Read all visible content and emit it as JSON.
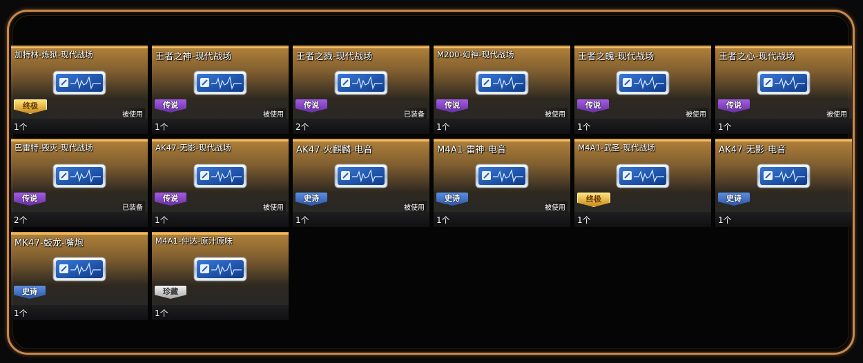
{
  "items": [
    {
      "title": "加特林-炼狱-现代战场",
      "rarity": "终极",
      "rarity_class": "ultimate",
      "status": "被使用",
      "count": "1个",
      "small": true
    },
    {
      "title": "王者之神-现代战场",
      "rarity": "传说",
      "rarity_class": "legend",
      "status": "被使用",
      "count": "1个",
      "small": false
    },
    {
      "title": "王者之戮-现代战场",
      "rarity": "传说",
      "rarity_class": "legend",
      "status": "已装备",
      "count": "2个",
      "small": false
    },
    {
      "title": "M200-幻神-现代战场",
      "rarity": "传说",
      "rarity_class": "legend",
      "status": "被使用",
      "count": "1个",
      "small": true
    },
    {
      "title": "王者之魄-现代战场",
      "rarity": "传说",
      "rarity_class": "legend",
      "status": "被使用",
      "count": "1个",
      "small": false
    },
    {
      "title": "王者之心-现代战场",
      "rarity": "传说",
      "rarity_class": "legend",
      "status": "被使用",
      "count": "1个",
      "small": false
    },
    {
      "title": "巴雷特-毁灭-现代战场",
      "rarity": "传说",
      "rarity_class": "legend",
      "status": "已装备",
      "count": "2个",
      "small": true
    },
    {
      "title": "AK47-无影-现代战场",
      "rarity": "传说",
      "rarity_class": "legend",
      "status": "被使用",
      "count": "1个",
      "small": true
    },
    {
      "title": "AK47-火麒麟-电音",
      "rarity": "史诗",
      "rarity_class": "epic",
      "status": "被使用",
      "count": "1个",
      "small": false
    },
    {
      "title": "M4A1-雷神-电音",
      "rarity": "史诗",
      "rarity_class": "epic",
      "status": "被使用",
      "count": "1个",
      "small": false
    },
    {
      "title": "M4A1-武圣-现代战场",
      "rarity": "终极",
      "rarity_class": "ultimate",
      "status": "",
      "count": "1个",
      "small": true
    },
    {
      "title": "AK47-无影-电音",
      "rarity": "史诗",
      "rarity_class": "epic",
      "status": "",
      "count": "1个",
      "small": false
    },
    {
      "title": "MK47-鼓龙-嘴炮",
      "rarity": "史诗",
      "rarity_class": "epic",
      "status": "",
      "count": "1个",
      "small": false
    },
    {
      "title": "M4A1-仲达-原汁原味",
      "rarity": "珍藏",
      "rarity_class": "rare",
      "status": "",
      "count": "1个",
      "small": true
    }
  ]
}
